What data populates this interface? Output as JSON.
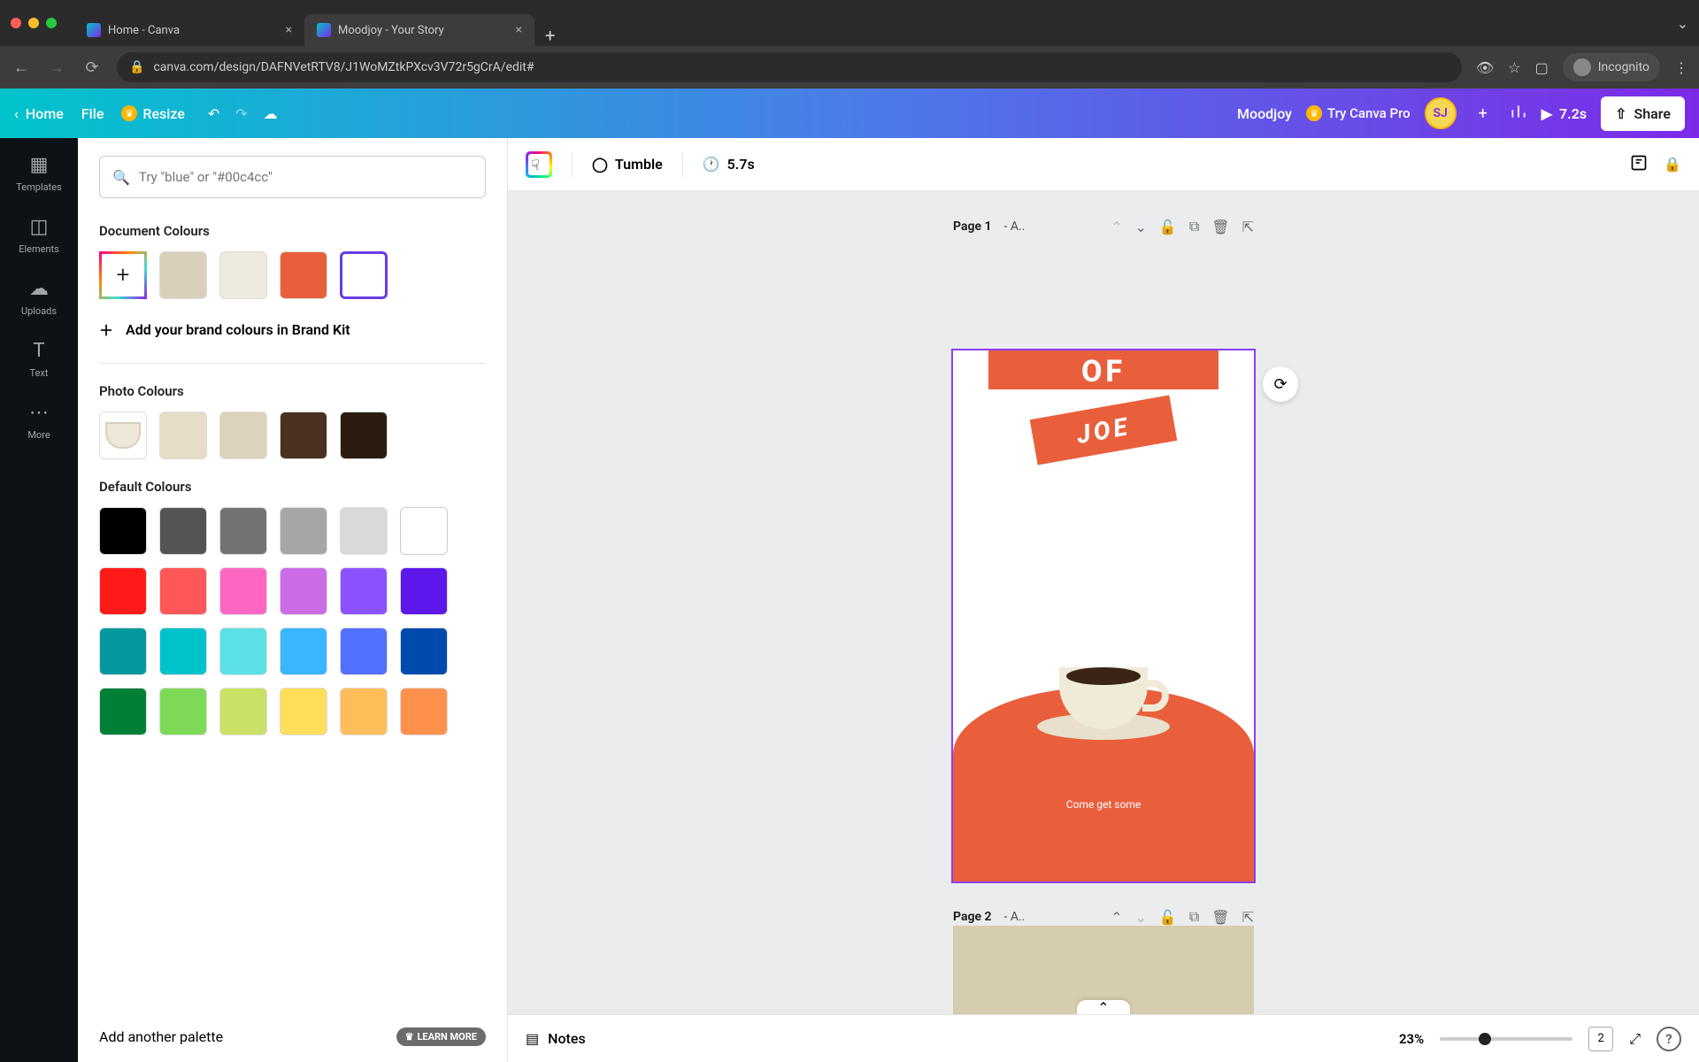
{
  "browser": {
    "tabs": [
      {
        "title": "Home - Canva",
        "active": false
      },
      {
        "title": "Moodjoy - Your Story",
        "active": true
      }
    ],
    "url": "canva.com/design/DAFNVetRTV8/J1WoMZtkPXcv3V72r5gCrA/edit#",
    "incognito_label": "Incognito"
  },
  "header": {
    "home": "Home",
    "file": "File",
    "resize": "Resize",
    "doc_name": "Moodjoy",
    "try_pro": "Try Canva Pro",
    "avatar_initials": "SJ",
    "present_duration": "7.2s",
    "share": "Share"
  },
  "side_rail": [
    {
      "label": "Templates"
    },
    {
      "label": "Elements"
    },
    {
      "label": "Uploads"
    },
    {
      "label": "Text"
    },
    {
      "label": "More"
    }
  ],
  "color_panel": {
    "search_placeholder": "Try \"blue\" or \"#00c4cc\"",
    "sections": {
      "document": {
        "title": "Document Colours",
        "swatches": [
          "#d9d0ba",
          "#eeeadd",
          "#e95f3c",
          "#ffffff"
        ]
      },
      "brand_kit_cta": "Add your brand colours in Brand Kit",
      "photo": {
        "title": "Photo Colours",
        "swatches": [
          "#e6ddc6",
          "#ddd3ba",
          "#4a3220",
          "#2a1d10"
        ]
      },
      "default": {
        "title": "Default Colours",
        "swatches": [
          "#000000",
          "#545454",
          "#737373",
          "#a6a6a6",
          "#d9d9d9",
          "#ffffff",
          "#ff1a1a",
          "#ff5757",
          "#ff66c4",
          "#cb6ce6",
          "#8c52ff",
          "#5e17eb",
          "#03989e",
          "#00c2cb",
          "#5ce1e6",
          "#38b6ff",
          "#5271ff",
          "#004aad",
          "#008037",
          "#7ed957",
          "#c9e265",
          "#ffde59",
          "#ffbd59",
          "#ff914d"
        ]
      }
    },
    "footer_cta": "Add another palette",
    "learn_more": "LEARN MORE"
  },
  "context_toolbar": {
    "tumble": "Tumble",
    "page_duration": "5.7s"
  },
  "pages": [
    {
      "label_prefix": "Page 1",
      "label_suffix": " - A..",
      "selected": true
    },
    {
      "label_prefix": "Page 2",
      "label_suffix": " - A..",
      "selected": false
    }
  ],
  "artwork": {
    "word_of": "OF",
    "word_joe": "JOE",
    "tagline": "Come get some"
  },
  "bottom_bar": {
    "notes": "Notes",
    "zoom": "23%",
    "page_count": "2"
  }
}
